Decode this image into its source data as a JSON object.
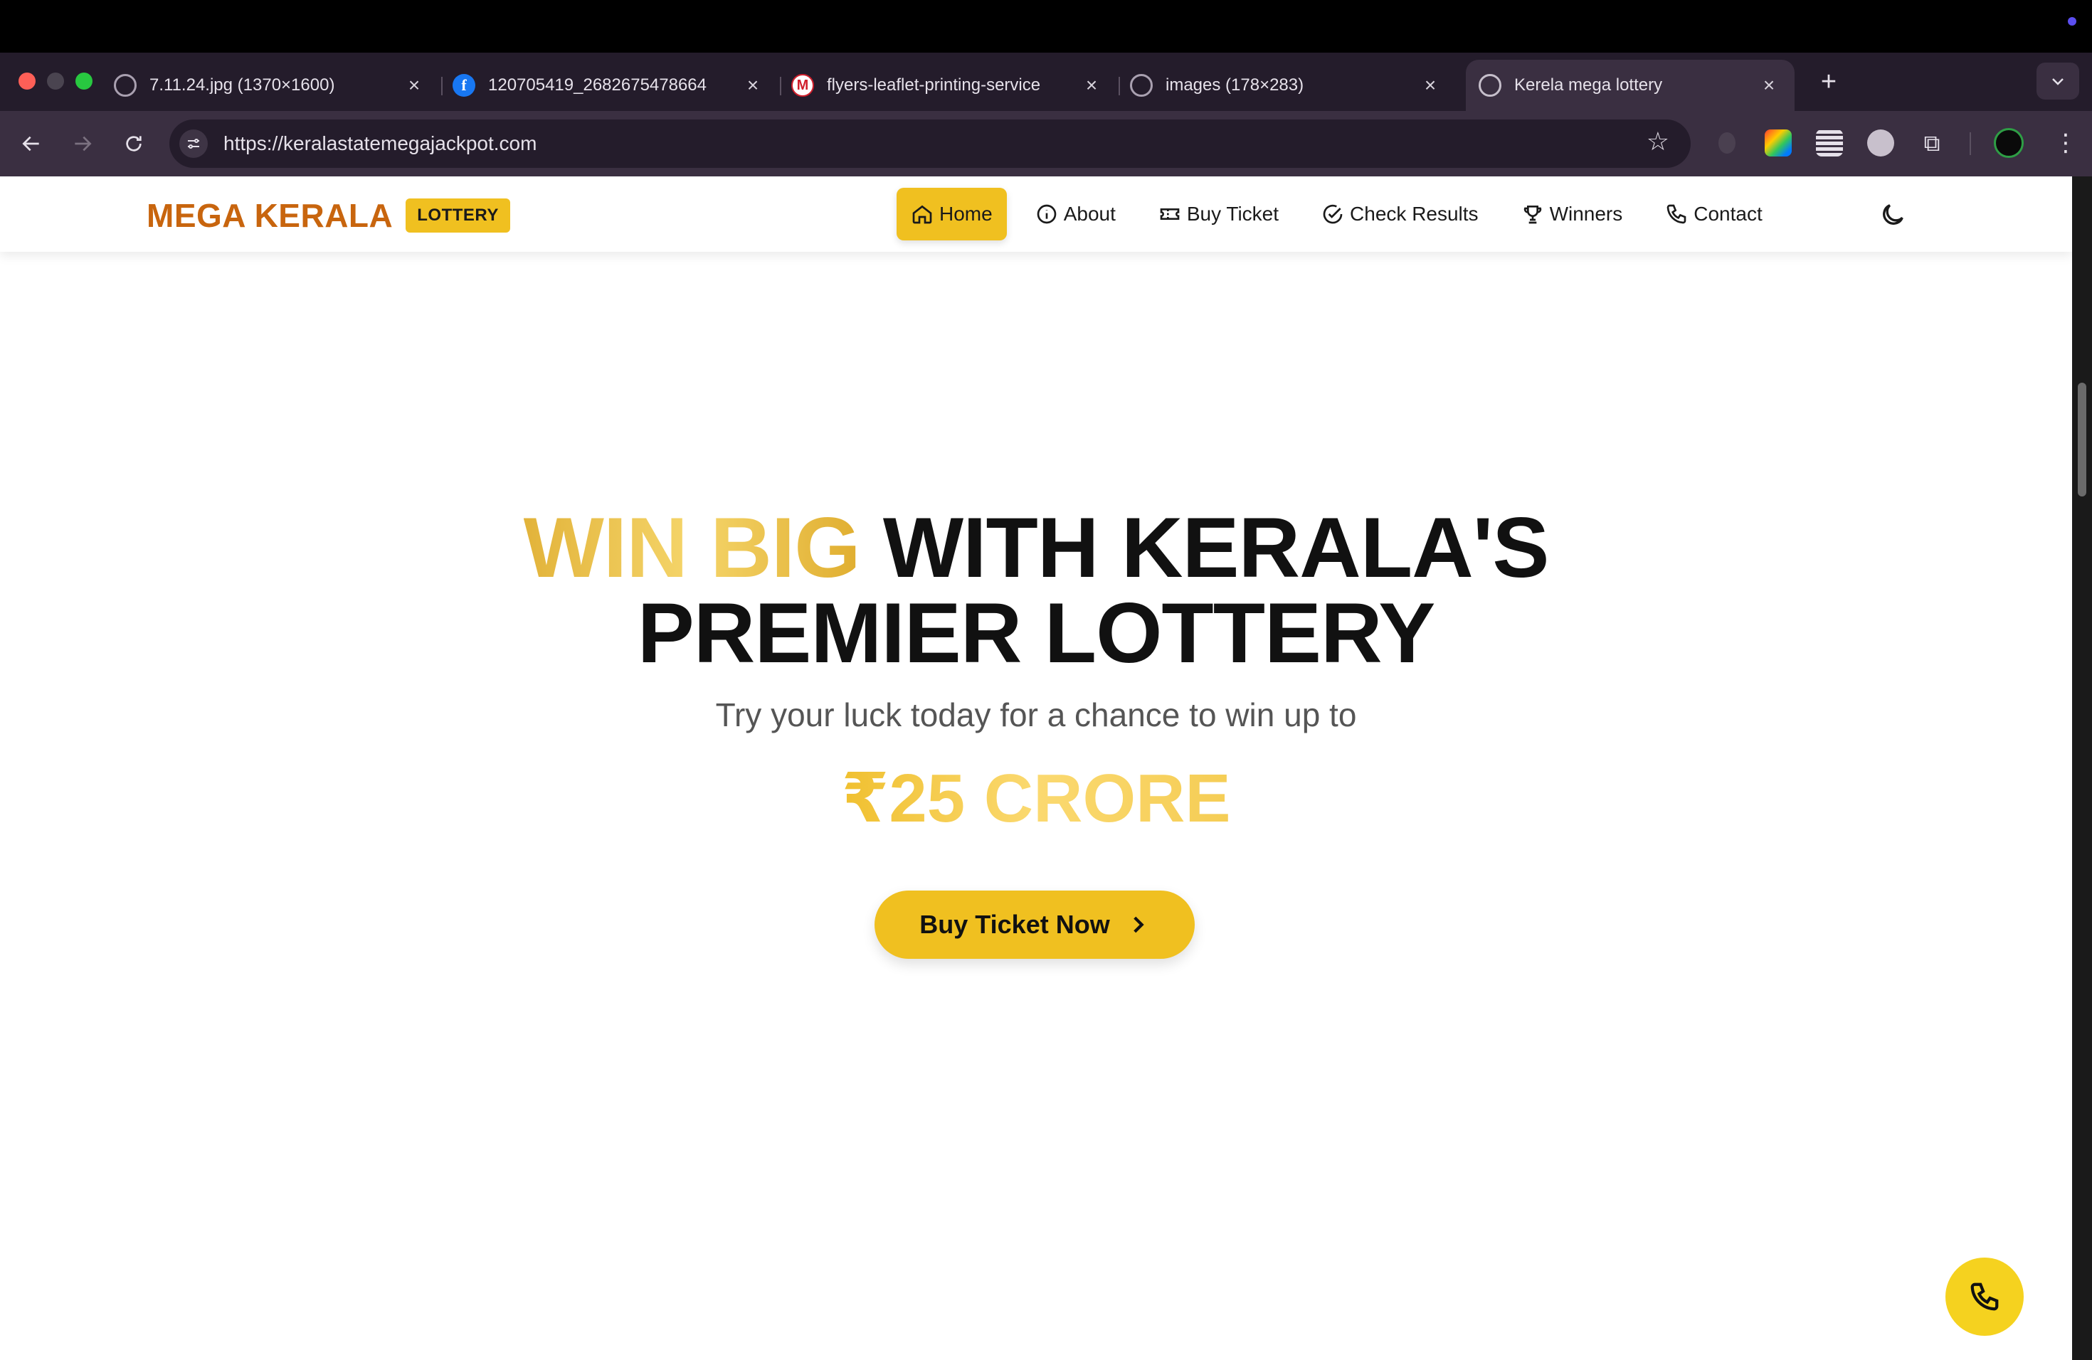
{
  "browser": {
    "tabs": [
      {
        "title": "7.11.24.jpg (1370×1600)",
        "favicon": "globe-icon",
        "active": false
      },
      {
        "title": "120705419_2682675478664",
        "favicon": "facebook-icon",
        "active": false
      },
      {
        "title": "flyers-leaflet-printing-service",
        "favicon": "m-logo-icon",
        "active": false
      },
      {
        "title": "images (178×283)",
        "favicon": "globe-icon",
        "active": false
      },
      {
        "title": "Kerela mega lottery",
        "favicon": "globe-icon",
        "active": true
      }
    ],
    "url": "https://keralastatemegajackpot.com"
  },
  "site": {
    "brand_name": "MEGA KERALA",
    "brand_badge": "LOTTERY",
    "nav": [
      {
        "label": "Home",
        "icon": "home-icon",
        "active": true
      },
      {
        "label": "About",
        "icon": "info-icon",
        "active": false
      },
      {
        "label": "Buy Ticket",
        "icon": "ticket-icon",
        "active": false
      },
      {
        "label": "Check Results",
        "icon": "check-circle-icon",
        "active": false
      },
      {
        "label": "Winners",
        "icon": "trophy-icon",
        "active": false
      },
      {
        "label": "Contact",
        "icon": "phone-icon",
        "active": false
      }
    ],
    "theme_toggle_icon": "moon-icon",
    "colors": {
      "brand": "#c8650e",
      "accent": "#f0c020",
      "gold_text": "#e8b93a"
    }
  },
  "hero": {
    "title_highlight": "WIN BIG",
    "title_rest": " WITH KERALA'S",
    "title_line2": "PREMIER LOTTERY",
    "subtitle": "Try your luck today for a chance to win up to",
    "prize": "₹25 CRORE",
    "cta_label": "Buy Ticket Now"
  },
  "fab": {
    "icon": "phone-icon"
  }
}
